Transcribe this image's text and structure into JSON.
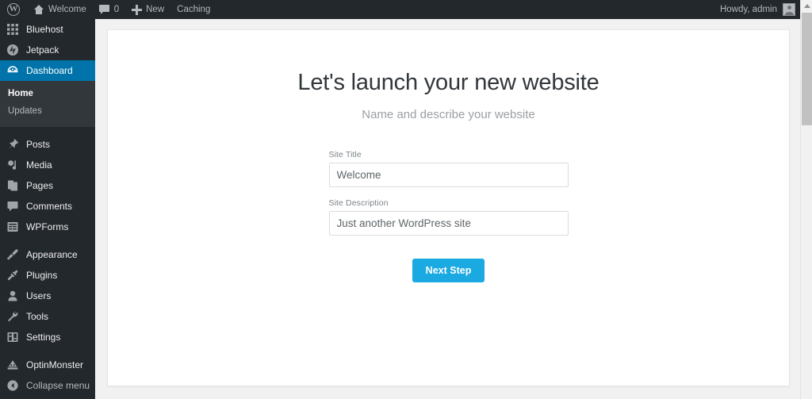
{
  "adminbar": {
    "logo_icon": "wordpress-logo-icon",
    "site_name": "Welcome",
    "home_icon": "home-icon",
    "comments_icon": "comment-bubble-icon",
    "comments_count": "0",
    "new_icon": "plus-icon",
    "new_label": "New",
    "caching_label": "Caching",
    "howdy": "Howdy, admin",
    "avatar_icon": "avatar-icon"
  },
  "sidebar": {
    "items": [
      {
        "label": "Bluehost",
        "icon": "grid-icon",
        "active": false
      },
      {
        "label": "Jetpack",
        "icon": "jetpack-icon",
        "active": false
      },
      {
        "label": "Dashboard",
        "icon": "dashboard-gauge-icon",
        "active": true
      },
      {
        "label": "Posts",
        "icon": "pin-icon",
        "active": false
      },
      {
        "label": "Media",
        "icon": "media-icon",
        "active": false
      },
      {
        "label": "Pages",
        "icon": "pages-icon",
        "active": false
      },
      {
        "label": "Comments",
        "icon": "comment-bubble-icon",
        "active": false
      },
      {
        "label": "WPForms",
        "icon": "form-icon",
        "active": false
      },
      {
        "label": "Appearance",
        "icon": "paintbrush-icon",
        "active": false
      },
      {
        "label": "Plugins",
        "icon": "plug-icon",
        "active": false
      },
      {
        "label": "Users",
        "icon": "user-icon",
        "active": false
      },
      {
        "label": "Tools",
        "icon": "wrench-icon",
        "active": false
      },
      {
        "label": "Settings",
        "icon": "settings-sliders-icon",
        "active": false
      },
      {
        "label": "OptinMonster",
        "icon": "optinmonster-icon",
        "active": false
      },
      {
        "label": "Collapse menu",
        "icon": "collapse-arrow-icon",
        "active": false
      }
    ],
    "submenu": [
      {
        "label": "Home",
        "current": true
      },
      {
        "label": "Updates",
        "current": false
      }
    ],
    "active_color": "#0073aa",
    "background_color": "#23282d",
    "submenu_background_color": "#32373c"
  },
  "wizard": {
    "title": "Let's launch your new website",
    "subtitle": "Name and describe your website",
    "fields": [
      {
        "label": "Site Title",
        "value": "Welcome",
        "placeholder": "Site Title"
      },
      {
        "label": "Site Description",
        "value": "Just another WordPress site",
        "placeholder": "Site Description"
      }
    ],
    "next_button": "Next Step",
    "button_color": "#1aa9e0"
  },
  "scrollbar": {
    "up_arrow_icon": "scroll-up-arrow-icon",
    "thumb": "scrollbar-thumb"
  }
}
